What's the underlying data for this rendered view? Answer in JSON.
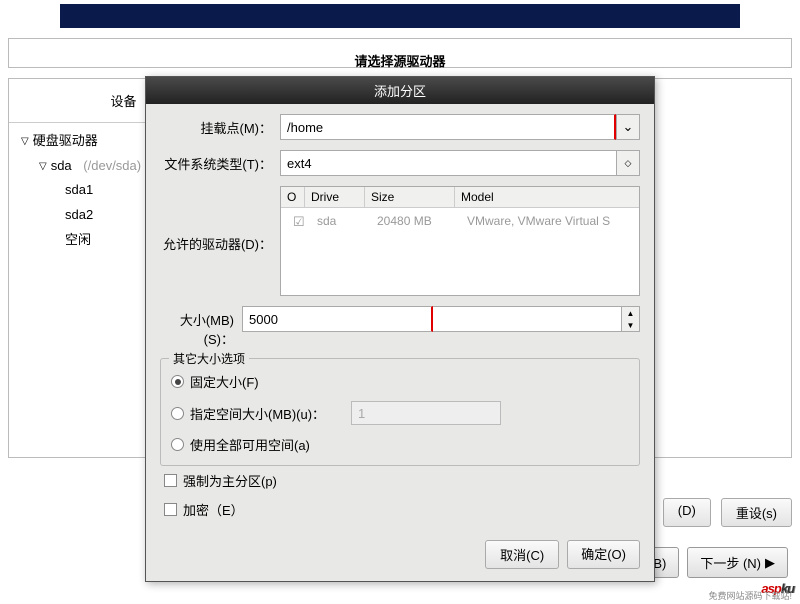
{
  "blocked_header": "请选择源驱动器",
  "tree": {
    "header": "设备",
    "root": "硬盘驱动器",
    "disk": "sda",
    "disk_path": "(/dev/sda)",
    "parts": [
      "sda1",
      "sda2",
      "空闲"
    ]
  },
  "modal": {
    "title": "添加分区",
    "mount_label": "挂载点(M)：",
    "mount_value": "/home",
    "fstype_label": "文件系统类型(T)：",
    "fstype_value": "ext4",
    "drives_label": "允许的驱动器(D)：",
    "drive_cols": {
      "check": "O",
      "drive": "Drive",
      "size": "Size",
      "model": "Model"
    },
    "drive_row": {
      "name": "sda",
      "size": "20480 MB",
      "model": "VMware, VMware Virtual S"
    },
    "size_label": "大小(MB)(S)：",
    "size_value": "5000",
    "sizegroup": {
      "legend": "其它大小选项",
      "fixed": "固定大小(F)",
      "fillto": "指定空间大小(MB)(u)：",
      "fillto_value": "1",
      "fillall": "使用全部可用空间(a)"
    },
    "force_primary": "强制为主分区(p)",
    "encrypt": "加密（E）",
    "cancel": "取消(C)",
    "ok": "确定(O)"
  },
  "bottom": {
    "d": "(D)",
    "reset": "重设(s)"
  },
  "nav": {
    "back": "返回 (B)",
    "next": "下一步 (N)"
  },
  "watermark": "aspku",
  "watermark_sub": "免费网站源码下载站!"
}
